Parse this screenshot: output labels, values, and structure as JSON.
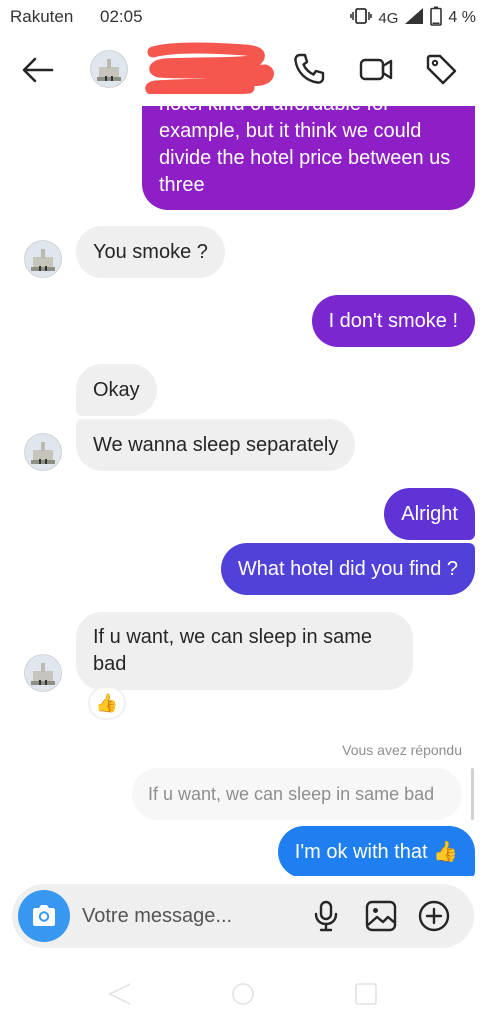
{
  "status_bar": {
    "carrier": "Rakuten",
    "time": "02:05",
    "network": "4G",
    "battery": "4 %"
  },
  "header": {
    "back_icon": "arrow-left-icon",
    "call_icon": "phone-icon",
    "video_icon": "video-camera-icon",
    "tag_icon": "tag-icon"
  },
  "messages": {
    "m1": "hotel kind of affordable for example, but it think we could divide the hotel price between us three",
    "m2": "You smoke ?",
    "m3": "I don't smoke !",
    "m4": "Okay",
    "m5": "We wanna sleep separately",
    "m6": "Alright",
    "m7": "What hotel did you find ?",
    "m8": "If u want, we can sleep in same bad",
    "m9_reaction": "👍",
    "reply_label": "Vous avez répondu",
    "reply_quote": "If u want, we can sleep in same bad",
    "m10": "I'm ok with that 👍"
  },
  "composer": {
    "placeholder": "Votre message...",
    "camera_icon": "camera-icon",
    "mic_icon": "microphone-icon",
    "gallery_icon": "image-icon",
    "add_icon": "plus-circle-icon"
  },
  "colors": {
    "incoming": "#efefef",
    "outgoing_purple": "#8e1fc6",
    "outgoing_violet": "#6d2fd8",
    "outgoing_indigo": "#5042d8",
    "outgoing_blue": "#1f7ff0",
    "camera_button": "#3897f0"
  }
}
